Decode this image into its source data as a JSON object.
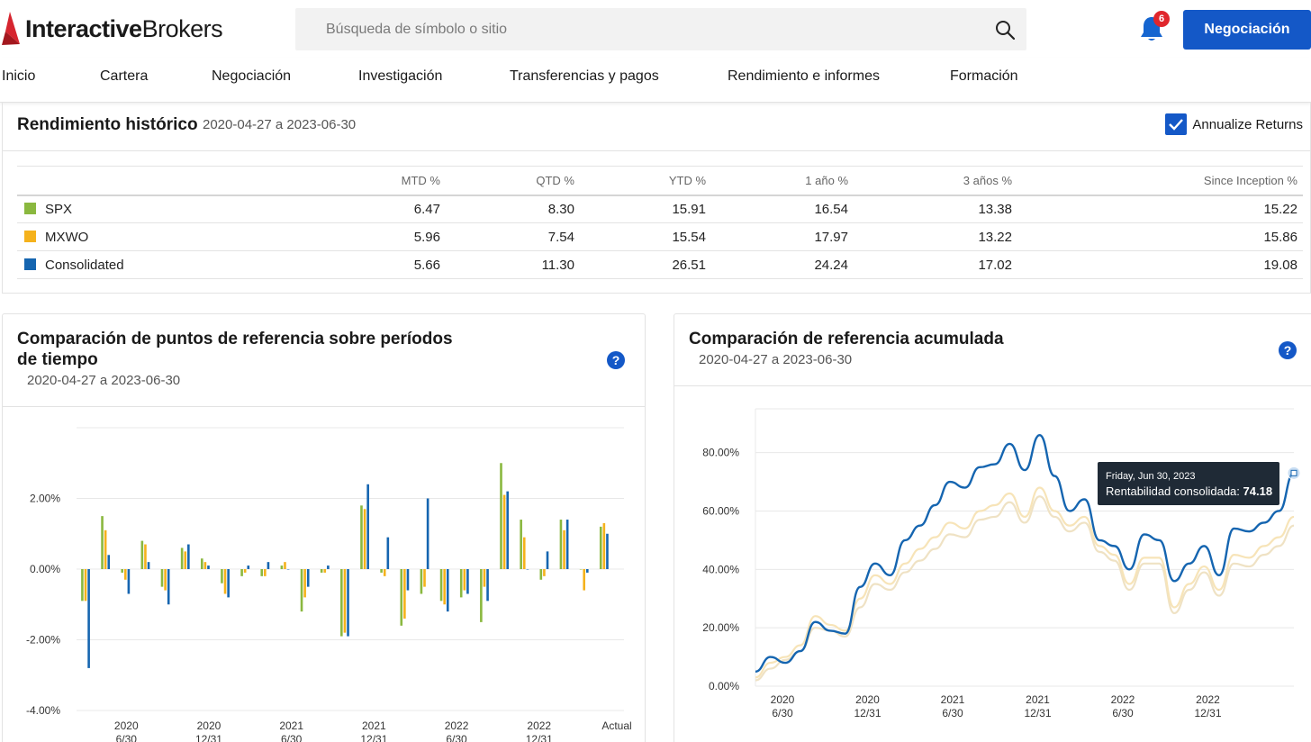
{
  "brand": {
    "bold": "Interactive",
    "regular": "Brokers"
  },
  "search": {
    "placeholder": "Búsqueda de símbolo o sitio"
  },
  "notifications": {
    "count": "6"
  },
  "header": {
    "trade_label": "Negociación"
  },
  "nav": [
    "Inicio",
    "Cartera",
    "Negociación",
    "Investigación",
    "Transferencias y pagos",
    "Rendimiento e informes",
    "Formación"
  ],
  "colors": {
    "accent": "#1458c7",
    "spx": "#8ab83f",
    "mxwo": "#f5b21c",
    "consolidated": "#1565b0",
    "badge": "#e0262c"
  },
  "historical": {
    "title": "Rendimiento histórico",
    "range": "2020-04-27 a 2023-06-30",
    "annualize_label": "Annualize Returns",
    "annualize_checked": true,
    "columns": [
      "",
      "MTD %",
      "QTD %",
      "YTD %",
      "1 año %",
      "3 años %",
      "Since Inception %"
    ],
    "rows": [
      {
        "name": "SPX",
        "values": [
          "6.47",
          "8.30",
          "15.91",
          "16.54",
          "13.38",
          "15.22"
        ]
      },
      {
        "name": "MXWO",
        "values": [
          "5.96",
          "7.54",
          "15.54",
          "17.97",
          "13.22",
          "15.86"
        ]
      },
      {
        "name": "Consolidated",
        "values": [
          "5.66",
          "11.30",
          "26.51",
          "24.24",
          "17.02",
          "19.08"
        ]
      }
    ]
  },
  "period_panel": {
    "title_line1": "Comparación de puntos de referencia sobre períodos",
    "title_line2": "de tiempo",
    "range": "2020-04-27 a 2023-06-30",
    "help": "?"
  },
  "cumulative_panel": {
    "title": "Comparación de referencia acumulada",
    "range": "2020-04-27 a 2023-06-30",
    "help": "?",
    "tooltip": {
      "date": "Friday, Jun 30, 2023",
      "label": "Rentabilidad consolidada:",
      "value": "74.18"
    }
  },
  "chart_data": [
    {
      "type": "bar",
      "ylim": [
        -4.0,
        4.0
      ],
      "yticks": [
        "2.00%",
        "0.00%",
        "-2.00%",
        "-4.00%"
      ],
      "ytick_values": [
        2,
        0,
        -2,
        -4
      ],
      "xticks": [
        {
          "label": "2020",
          "sub": "6/30",
          "index": 1
        },
        {
          "label": "2020",
          "sub": "12/31",
          "index": 7
        },
        {
          "label": "2021",
          "sub": "6/30",
          "index": 13
        },
        {
          "label": "2021",
          "sub": "12/31",
          "index": 19
        },
        {
          "label": "2022",
          "sub": "6/30",
          "index": 25
        },
        {
          "label": "2022",
          "sub": "12/31",
          "index": 31
        },
        {
          "label": "Actual",
          "sub": "",
          "index": 38
        }
      ],
      "series": [
        {
          "values": [
            -0.9,
            1.5,
            -0.1,
            0.8,
            -0.5,
            0.6,
            0.3,
            -0.4,
            -0.2,
            -0.2,
            0.1,
            -1.2,
            -0.1,
            -1.9,
            1.8,
            -0.1,
            -1.6,
            -0.7,
            -0.9,
            -0.8,
            -1.5,
            3.0,
            1.4,
            -0.3,
            1.4,
            0.0,
            1.2
          ]
        },
        {
          "values": [
            -0.9,
            1.1,
            -0.3,
            0.7,
            -0.6,
            0.5,
            0.2,
            -0.7,
            -0.1,
            -0.2,
            0.2,
            -0.8,
            -0.1,
            -1.8,
            1.7,
            -0.2,
            -1.4,
            -0.5,
            -1.0,
            -0.6,
            -0.5,
            2.1,
            0.9,
            -0.2,
            1.1,
            -0.6,
            1.3
          ]
        },
        {
          "values": [
            -2.8,
            0.4,
            -0.7,
            0.2,
            -1.0,
            0.7,
            0.1,
            -0.8,
            0.1,
            0.2,
            0.0,
            -0.5,
            0.1,
            -1.9,
            2.4,
            0.9,
            -0.6,
            2.0,
            -1.2,
            -0.7,
            -0.9,
            2.2,
            0.0,
            0.5,
            1.4,
            -0.1,
            1.0
          ]
        }
      ]
    },
    {
      "type": "line",
      "ylim": [
        0,
        95
      ],
      "yticks": [
        "80.00%",
        "60.00%",
        "40.00%",
        "20.00%",
        "0.00%"
      ],
      "ytick_values": [
        80,
        60,
        40,
        20,
        0
      ],
      "xticks": [
        {
          "label": "2020",
          "sub": "6/30",
          "x": 2
        },
        {
          "label": "2020",
          "sub": "12/31",
          "x": 8
        },
        {
          "label": "2021",
          "sub": "6/30",
          "x": 14
        },
        {
          "label": "2021",
          "sub": "12/31",
          "x": 20
        },
        {
          "label": "2022",
          "sub": "6/30",
          "x": 26
        },
        {
          "label": "2022",
          "sub": "12/31",
          "x": 32
        }
      ],
      "series": [
        {
          "values": [
            5,
            10,
            8,
            12,
            22,
            19,
            18,
            34,
            42,
            38,
            50,
            55,
            62,
            70,
            68,
            75,
            76,
            83,
            74,
            86,
            72,
            60,
            64,
            50,
            48,
            40,
            52,
            50,
            36,
            42,
            48,
            38,
            54,
            53,
            56,
            60,
            73
          ]
        },
        {
          "values": [
            3,
            8,
            10,
            14,
            24,
            21,
            19,
            30,
            38,
            35,
            42,
            47,
            51,
            56,
            54,
            60,
            62,
            66,
            58,
            68,
            60,
            55,
            58,
            48,
            45,
            35,
            44,
            44,
            27,
            35,
            41,
            33,
            45,
            44,
            48,
            51,
            58
          ]
        },
        {
          "values": [
            2,
            6,
            9,
            12,
            20,
            19,
            17,
            27,
            35,
            33,
            39,
            43,
            47,
            52,
            51,
            57,
            58,
            63,
            56,
            65,
            58,
            53,
            56,
            46,
            43,
            33,
            42,
            42,
            25,
            33,
            39,
            31,
            42,
            41,
            45,
            48,
            55
          ]
        }
      ]
    }
  ]
}
